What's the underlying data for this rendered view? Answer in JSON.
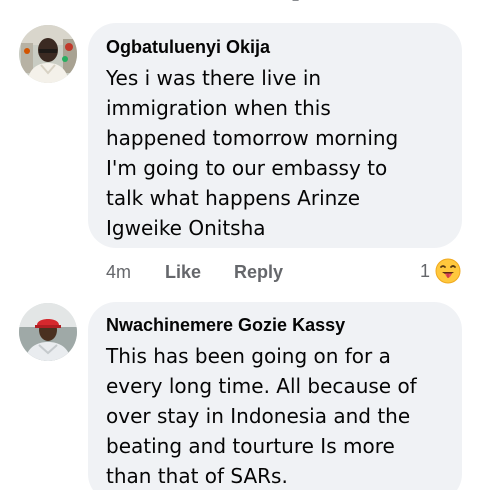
{
  "comments": [
    {
      "author": "Ogbatuluenyi Okija",
      "lines": [
        "Yes i was there live in",
        "immigration when this",
        "happened tomorrow morning",
        "I'm going to our embassy to",
        "talk what happens Arinze",
        "Igweike Onitsha"
      ],
      "time": "4m",
      "like_label": "Like",
      "reply_label": "Reply",
      "reaction_count": "1",
      "reaction_icon": "tongue-out-face-emoji"
    },
    {
      "author": "Nwachinemere Gozie Kassy",
      "lines": [
        "This has been going on for a",
        "every long time. All because of",
        "over stay in Indonesia and the",
        "beating and tourture Is more",
        "than that of SARs."
      ]
    }
  ],
  "colors": {
    "bubble": "#f0f2f5",
    "text": "#050505",
    "secondary_text": "#65676b"
  }
}
